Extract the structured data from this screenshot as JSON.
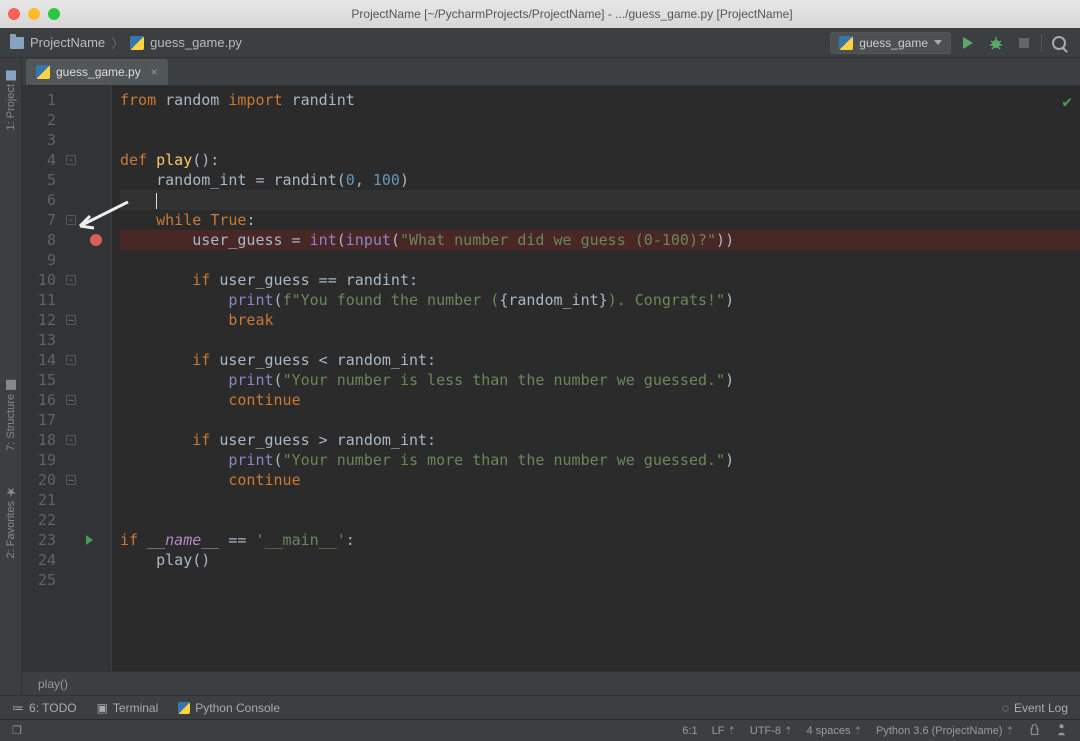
{
  "window": {
    "title": "ProjectName [~/PycharmProjects/ProjectName] - .../guess_game.py [ProjectName]"
  },
  "toolbar": {
    "breadcrumb_root": "ProjectName",
    "breadcrumb_file": "guess_game.py",
    "run_config": "guess_game"
  },
  "side_tools": {
    "project": "1: Project",
    "structure": "7: Structure",
    "favorites": "2: Favorites"
  },
  "tabs": {
    "active": "guess_game.py"
  },
  "gutter": {
    "breakpoint_line": 8,
    "run_marker_line": 23,
    "current_line": 6
  },
  "lines": [
    {
      "n": 1,
      "seg": [
        {
          "t": "from ",
          "c": "kw"
        },
        {
          "t": "random ",
          "c": ""
        },
        {
          "t": "import ",
          "c": "kw"
        },
        {
          "t": "randint",
          "c": ""
        }
      ]
    },
    {
      "n": 2,
      "seg": []
    },
    {
      "n": 3,
      "seg": []
    },
    {
      "n": 4,
      "seg": [
        {
          "t": "def ",
          "c": "kw"
        },
        {
          "t": "play",
          "c": "fn"
        },
        {
          "t": "():",
          "c": ""
        }
      ]
    },
    {
      "n": 5,
      "seg": [
        {
          "t": "    random_int = randint(",
          "c": ""
        },
        {
          "t": "0",
          "c": "num"
        },
        {
          "t": ", ",
          "c": ""
        },
        {
          "t": "100",
          "c": "num"
        },
        {
          "t": ")",
          "c": ""
        }
      ]
    },
    {
      "n": 6,
      "seg": [
        {
          "t": "    ",
          "c": ""
        }
      ],
      "cursor": true,
      "hl": true
    },
    {
      "n": 7,
      "seg": [
        {
          "t": "    ",
          "c": ""
        },
        {
          "t": "while ",
          "c": "kw"
        },
        {
          "t": "True",
          "c": "kw"
        },
        {
          "t": ":",
          "c": ""
        }
      ]
    },
    {
      "n": 8,
      "seg": [
        {
          "t": "        user_guess = ",
          "c": ""
        },
        {
          "t": "int",
          "c": "builtin"
        },
        {
          "t": "(",
          "c": ""
        },
        {
          "t": "input",
          "c": "builtin"
        },
        {
          "t": "(",
          "c": ""
        },
        {
          "t": "\"What number did we guess (0-100)?\"",
          "c": "str"
        },
        {
          "t": "))",
          "c": ""
        }
      ],
      "bp": true
    },
    {
      "n": 9,
      "seg": []
    },
    {
      "n": 10,
      "seg": [
        {
          "t": "        ",
          "c": ""
        },
        {
          "t": "if ",
          "c": "kw"
        },
        {
          "t": "user_guess == randint:",
          "c": ""
        }
      ]
    },
    {
      "n": 11,
      "seg": [
        {
          "t": "            ",
          "c": ""
        },
        {
          "t": "print",
          "c": "builtin"
        },
        {
          "t": "(",
          "c": ""
        },
        {
          "t": "f\"You found the number (",
          "c": "str"
        },
        {
          "t": "{random_int}",
          "c": ""
        },
        {
          "t": "). Congrats!\"",
          "c": "str"
        },
        {
          "t": ")",
          "c": ""
        }
      ]
    },
    {
      "n": 12,
      "seg": [
        {
          "t": "            ",
          "c": ""
        },
        {
          "t": "break",
          "c": "kw"
        }
      ]
    },
    {
      "n": 13,
      "seg": []
    },
    {
      "n": 14,
      "seg": [
        {
          "t": "        ",
          "c": ""
        },
        {
          "t": "if ",
          "c": "kw"
        },
        {
          "t": "user_guess < random_int:",
          "c": ""
        }
      ]
    },
    {
      "n": 15,
      "seg": [
        {
          "t": "            ",
          "c": ""
        },
        {
          "t": "print",
          "c": "builtin"
        },
        {
          "t": "(",
          "c": ""
        },
        {
          "t": "\"Your number is less than the number we guessed.\"",
          "c": "str"
        },
        {
          "t": ")",
          "c": ""
        }
      ]
    },
    {
      "n": 16,
      "seg": [
        {
          "t": "            ",
          "c": ""
        },
        {
          "t": "continue",
          "c": "kw"
        }
      ]
    },
    {
      "n": 17,
      "seg": []
    },
    {
      "n": 18,
      "seg": [
        {
          "t": "        ",
          "c": ""
        },
        {
          "t": "if ",
          "c": "kw"
        },
        {
          "t": "user_guess > random_int:",
          "c": ""
        }
      ]
    },
    {
      "n": 19,
      "seg": [
        {
          "t": "            ",
          "c": ""
        },
        {
          "t": "print",
          "c": "builtin"
        },
        {
          "t": "(",
          "c": ""
        },
        {
          "t": "\"Your number is more than the number we guessed.\"",
          "c": "str"
        },
        {
          "t": ")",
          "c": ""
        }
      ]
    },
    {
      "n": 20,
      "seg": [
        {
          "t": "            ",
          "c": ""
        },
        {
          "t": "continue",
          "c": "kw"
        }
      ]
    },
    {
      "n": 21,
      "seg": []
    },
    {
      "n": 22,
      "seg": []
    },
    {
      "n": 23,
      "seg": [
        {
          "t": "if ",
          "c": "kw"
        },
        {
          "t": "__name__",
          "c": "dunder"
        },
        {
          "t": " == ",
          "c": ""
        },
        {
          "t": "'__main__'",
          "c": "str"
        },
        {
          "t": ":",
          "c": ""
        }
      ]
    },
    {
      "n": 24,
      "seg": [
        {
          "t": "    play()",
          "c": ""
        }
      ]
    },
    {
      "n": 25,
      "seg": []
    }
  ],
  "crumb": "play()",
  "bottom_tools": {
    "todo": "6: TODO",
    "terminal": "Terminal",
    "python_console": "Python Console",
    "event_log": "Event Log"
  },
  "status": {
    "pos": "6:1",
    "line_sep": "LF",
    "encoding": "UTF-8",
    "indent": "4 spaces",
    "sdk": "Python 3.6 (ProjectName)"
  }
}
